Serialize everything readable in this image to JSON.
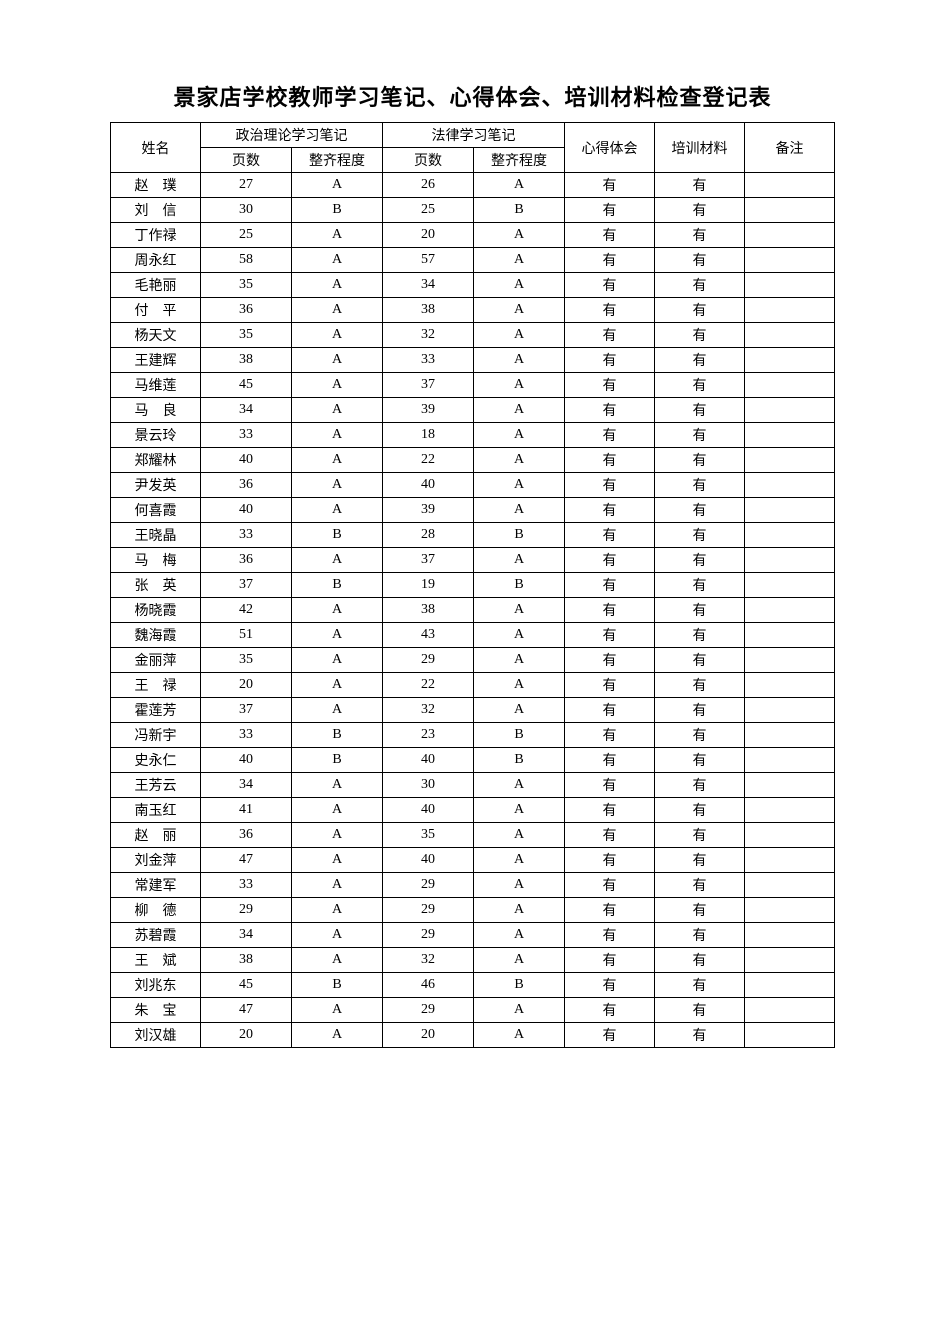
{
  "title": "景家店学校教师学习笔记、心得体会、培训材料检查登记表",
  "headers": {
    "name": "姓名",
    "politics": "政治理论学习笔记",
    "law": "法律学习笔记",
    "pages": "页数",
    "neatness": "整齐程度",
    "experience": "心得体会",
    "training": "培训材料",
    "remark": "备注"
  },
  "rows": [
    {
      "name": "赵　璞",
      "p_pages": "27",
      "p_neat": "A",
      "l_pages": "26",
      "l_neat": "A",
      "exp": "有",
      "train": "有",
      "remark": ""
    },
    {
      "name": "刘　信",
      "p_pages": "30",
      "p_neat": "B",
      "l_pages": "25",
      "l_neat": "B",
      "exp": "有",
      "train": "有",
      "remark": ""
    },
    {
      "name": "丁作禄",
      "p_pages": "25",
      "p_neat": "A",
      "l_pages": "20",
      "l_neat": "A",
      "exp": "有",
      "train": "有",
      "remark": ""
    },
    {
      "name": "周永红",
      "p_pages": "58",
      "p_neat": "A",
      "l_pages": "57",
      "l_neat": "A",
      "exp": "有",
      "train": "有",
      "remark": ""
    },
    {
      "name": "毛艳丽",
      "p_pages": "35",
      "p_neat": "A",
      "l_pages": "34",
      "l_neat": "A",
      "exp": "有",
      "train": "有",
      "remark": ""
    },
    {
      "name": "付　平",
      "p_pages": "36",
      "p_neat": "A",
      "l_pages": "38",
      "l_neat": "A",
      "exp": "有",
      "train": "有",
      "remark": ""
    },
    {
      "name": "杨天文",
      "p_pages": "35",
      "p_neat": "A",
      "l_pages": "32",
      "l_neat": "A",
      "exp": "有",
      "train": "有",
      "remark": ""
    },
    {
      "name": "王建辉",
      "p_pages": "38",
      "p_neat": "A",
      "l_pages": "33",
      "l_neat": "A",
      "exp": "有",
      "train": "有",
      "remark": ""
    },
    {
      "name": "马维莲",
      "p_pages": "45",
      "p_neat": "A",
      "l_pages": "37",
      "l_neat": "A",
      "exp": "有",
      "train": "有",
      "remark": ""
    },
    {
      "name": "马　良",
      "p_pages": "34",
      "p_neat": "A",
      "l_pages": "39",
      "l_neat": "A",
      "exp": "有",
      "train": "有",
      "remark": ""
    },
    {
      "name": "景云玲",
      "p_pages": "33",
      "p_neat": "A",
      "l_pages": "18",
      "l_neat": "A",
      "exp": "有",
      "train": "有",
      "remark": ""
    },
    {
      "name": "郑耀林",
      "p_pages": "40",
      "p_neat": "A",
      "l_pages": "22",
      "l_neat": "A",
      "exp": "有",
      "train": "有",
      "remark": ""
    },
    {
      "name": "尹发英",
      "p_pages": "36",
      "p_neat": "A",
      "l_pages": "40",
      "l_neat": "A",
      "exp": "有",
      "train": "有",
      "remark": ""
    },
    {
      "name": "何喜霞",
      "p_pages": "40",
      "p_neat": "A",
      "l_pages": "39",
      "l_neat": "A",
      "exp": "有",
      "train": "有",
      "remark": ""
    },
    {
      "name": "王晓晶",
      "p_pages": "33",
      "p_neat": "B",
      "l_pages": "28",
      "l_neat": "B",
      "exp": "有",
      "train": "有",
      "remark": ""
    },
    {
      "name": "马　梅",
      "p_pages": "36",
      "p_neat": "A",
      "l_pages": "37",
      "l_neat": "A",
      "exp": "有",
      "train": "有",
      "remark": ""
    },
    {
      "name": "张　英",
      "p_pages": "37",
      "p_neat": "B",
      "l_pages": "19",
      "l_neat": "B",
      "exp": "有",
      "train": "有",
      "remark": ""
    },
    {
      "name": "杨晓霞",
      "p_pages": "42",
      "p_neat": "A",
      "l_pages": "38",
      "l_neat": "A",
      "exp": "有",
      "train": "有",
      "remark": ""
    },
    {
      "name": "魏海霞",
      "p_pages": "51",
      "p_neat": "A",
      "l_pages": "43",
      "l_neat": "A",
      "exp": "有",
      "train": "有",
      "remark": ""
    },
    {
      "name": "金丽萍",
      "p_pages": "35",
      "p_neat": "A",
      "l_pages": "29",
      "l_neat": "A",
      "exp": "有",
      "train": "有",
      "remark": ""
    },
    {
      "name": "王　禄",
      "p_pages": "20",
      "p_neat": "A",
      "l_pages": "22",
      "l_neat": "A",
      "exp": "有",
      "train": "有",
      "remark": ""
    },
    {
      "name": "霍莲芳",
      "p_pages": "37",
      "p_neat": "A",
      "l_pages": "32",
      "l_neat": "A",
      "exp": "有",
      "train": "有",
      "remark": ""
    },
    {
      "name": "冯新宇",
      "p_pages": "33",
      "p_neat": "B",
      "l_pages": "23",
      "l_neat": "B",
      "exp": "有",
      "train": "有",
      "remark": ""
    },
    {
      "name": "史永仁",
      "p_pages": "40",
      "p_neat": "B",
      "l_pages": "40",
      "l_neat": "B",
      "exp": "有",
      "train": "有",
      "remark": ""
    },
    {
      "name": "王芳云",
      "p_pages": "34",
      "p_neat": "A",
      "l_pages": "30",
      "l_neat": "A",
      "exp": "有",
      "train": "有",
      "remark": ""
    },
    {
      "name": "南玉红",
      "p_pages": "41",
      "p_neat": "A",
      "l_pages": "40",
      "l_neat": "A",
      "exp": "有",
      "train": "有",
      "remark": ""
    },
    {
      "name": "赵　丽",
      "p_pages": "36",
      "p_neat": "A",
      "l_pages": "35",
      "l_neat": "A",
      "exp": "有",
      "train": "有",
      "remark": ""
    },
    {
      "name": "刘金萍",
      "p_pages": "47",
      "p_neat": "A",
      "l_pages": "40",
      "l_neat": "A",
      "exp": "有",
      "train": "有",
      "remark": ""
    },
    {
      "name": "常建军",
      "p_pages": "33",
      "p_neat": "A",
      "l_pages": "29",
      "l_neat": "A",
      "exp": "有",
      "train": "有",
      "remark": ""
    },
    {
      "name": "柳　德",
      "p_pages": "29",
      "p_neat": "A",
      "l_pages": "29",
      "l_neat": "A",
      "exp": "有",
      "train": "有",
      "remark": ""
    },
    {
      "name": "苏碧霞",
      "p_pages": "34",
      "p_neat": "A",
      "l_pages": "29",
      "l_neat": "A",
      "exp": "有",
      "train": "有",
      "remark": ""
    },
    {
      "name": "王　斌",
      "p_pages": "38",
      "p_neat": "A",
      "l_pages": "32",
      "l_neat": "A",
      "exp": "有",
      "train": "有",
      "remark": ""
    },
    {
      "name": "刘兆东",
      "p_pages": "45",
      "p_neat": "B",
      "l_pages": "46",
      "l_neat": "B",
      "exp": "有",
      "train": "有",
      "remark": ""
    },
    {
      "name": "朱　宝",
      "p_pages": "47",
      "p_neat": "A",
      "l_pages": "29",
      "l_neat": "A",
      "exp": "有",
      "train": "有",
      "remark": ""
    },
    {
      "name": "刘汉雄",
      "p_pages": "20",
      "p_neat": "A",
      "l_pages": "20",
      "l_neat": "A",
      "exp": "有",
      "train": "有",
      "remark": ""
    }
  ]
}
